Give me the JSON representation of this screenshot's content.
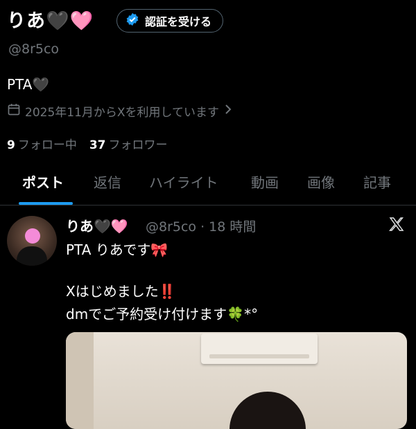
{
  "profile": {
    "name": "りあ🖤🩷",
    "verify_button": "認証を受ける",
    "handle": "@8r5co",
    "bio": "PTA🖤",
    "joined": "2025年11月からXを利用しています",
    "following_count": "9",
    "following_label": "フォロー中",
    "followers_count": "37",
    "followers_label": "フォロワー"
  },
  "tabs": [
    {
      "label": "ポスト"
    },
    {
      "label": "返信"
    },
    {
      "label": "ハイライト"
    },
    {
      "label": "動画"
    },
    {
      "label": "画像"
    },
    {
      "label": "記事"
    }
  ],
  "tweet": {
    "name": "りあ🖤🩷",
    "handle_time": "@8r5co · 18 時間",
    "line1": "PTA りあです🎀",
    "line2": "Xはじめました‼️",
    "line3": "dmでご予約受け付けます🍀*°"
  },
  "colors": {
    "accent": "#1d9bf0",
    "secondary_text": "#71767b",
    "background": "#000000"
  }
}
